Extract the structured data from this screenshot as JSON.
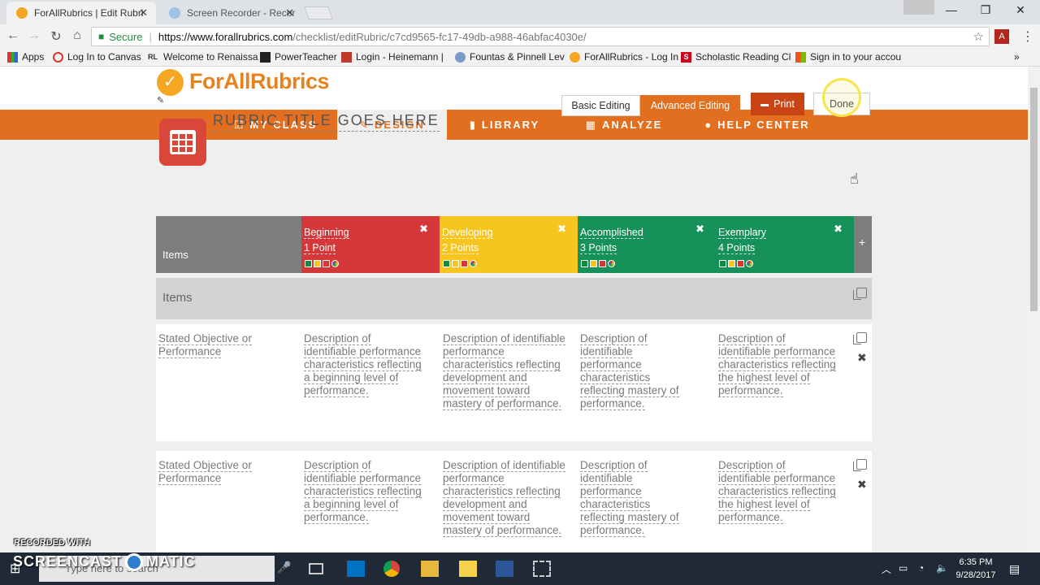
{
  "browser": {
    "tabs": [
      {
        "title": "ForAllRubrics | Edit Rubri",
        "active": true
      },
      {
        "title": "Screen Recorder - Recor",
        "active": false
      }
    ],
    "window_controls": [
      "—",
      "❐",
      "✕"
    ],
    "secure_label": "Secure",
    "url_host": "https://www.forallrubrics.com",
    "url_path": "/checklist/editRubric/c7cd9565-fc17-49db-a988-46abfac4030e/",
    "bookmarks": [
      {
        "label": "Apps",
        "icon": "apps-grid-icon"
      },
      {
        "label": "Log In to Canvas",
        "icon": "canvas-icon"
      },
      {
        "label": "Welcome to Renaissa",
        "icon": "renaissance-icon",
        "prefix": "RL"
      },
      {
        "label": "PowerTeacher",
        "icon": "powerteacher-icon"
      },
      {
        "label": "Login - Heinemann |",
        "icon": "heinemann-icon"
      },
      {
        "label": "Fountas & Pinnell Lev",
        "icon": "fountas-icon"
      },
      {
        "label": "ForAllRubrics - Log In",
        "icon": "forallrubrics-icon"
      },
      {
        "label": "Scholastic Reading Cl",
        "icon": "scholastic-icon",
        "prefix": "S"
      },
      {
        "label": "Sign in to your accou",
        "icon": "microsoft-icon"
      }
    ]
  },
  "site": {
    "logo_text": "ForAllRubrics",
    "nav": [
      {
        "label": "MY CLASS",
        "icon": "✎",
        "active": false
      },
      {
        "label": "DESIGN",
        "icon": "✎",
        "active": true
      },
      {
        "label": "LIBRARY",
        "icon": "▮",
        "active": false
      },
      {
        "label": "ANALYZE",
        "icon": "▦",
        "active": false
      },
      {
        "label": "HELP CENTER",
        "icon": "●",
        "active": false
      }
    ]
  },
  "toolbar": {
    "rubric_title": "RUBRIC TITLE GOES HERE",
    "basic_label": "Basic Editing",
    "advanced_label": "Advanced Editing",
    "print_label": "Print",
    "done_label": "Done"
  },
  "rubric": {
    "items_header": "Items",
    "levels": [
      {
        "name": "Beginning",
        "points": "1 Point",
        "color": "#d5383a"
      },
      {
        "name": "Developing",
        "points": "2 Points",
        "color": "#f7c51f"
      },
      {
        "name": "Accomplished",
        "points": "3 Points",
        "color": "#17915a"
      },
      {
        "name": "Exemplary",
        "points": "4 Points",
        "color": "#17915a"
      }
    ],
    "swatch_colors": [
      "#138a3e",
      "#f7c51f",
      "#d5383a",
      "#7b5cd6"
    ],
    "add_label": "+",
    "section_label": "Items",
    "rows": [
      {
        "objective": "Stated Objective or Performance",
        "descriptions": [
          "Description of identifiable performance characteristics reflecting a beginning level of performance.",
          "Description of identifiable performance characteristics reflecting development and movement toward mastery of performance.",
          "Description of identifiable performance characteristics reflecting mastery of performance.",
          "Description of identifiable performance characteristics reflecting the highest level of performance."
        ]
      },
      {
        "objective": "Stated Objective or Performance",
        "descriptions": [
          "Description of identifiable performance characteristics reflecting a beginning level of performance.",
          "Description of identifiable performance characteristics reflecting development and movement toward mastery of performance.",
          "Description of identifiable performance characteristics reflecting mastery of performance.",
          "Description of identifiable performance characteristics reflecting the highest level of performance."
        ]
      }
    ]
  },
  "taskbar": {
    "search_placeholder": "Type here to search",
    "time": "6:35 PM",
    "date": "9/28/2017"
  },
  "watermark": {
    "line1": "RECORDED WITH",
    "line2a": "SCREENCAST",
    "line2b": "MATIC"
  }
}
